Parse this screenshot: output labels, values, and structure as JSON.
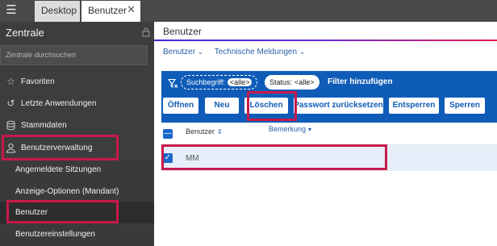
{
  "topbar": {
    "menu_icon": "hamburger-menu-icon",
    "tabs": [
      {
        "label": "Desktop"
      },
      {
        "label": "Benutzer",
        "close_icon": "close-icon"
      }
    ]
  },
  "sidebar": {
    "title": "Zentrale",
    "search_placeholder": "Zentrale durchsuchen",
    "items": [
      {
        "label": "Favoriten",
        "icon": "star-icon"
      },
      {
        "label": "Letzte Anwendungen",
        "icon": "history-icon"
      },
      {
        "label": "Stammdaten",
        "icon": "database-icon"
      },
      {
        "label": "Benutzerverwaltung",
        "icon": "user-icon"
      }
    ],
    "sub_items": [
      {
        "label": "Angemeldete Sitzungen"
      },
      {
        "label": "Anzeige-Optionen (Mandant)"
      },
      {
        "label": "Benutzer"
      },
      {
        "label": "Benutzereinstellungen"
      }
    ]
  },
  "main": {
    "title": "Benutzer",
    "breadcrumb": [
      {
        "label": "Benutzer"
      },
      {
        "label": "Technische Meldungen"
      }
    ],
    "filter": {
      "search_label": "Suchbegriff:",
      "search_value": "<alle>",
      "status_label": "Status:",
      "status_value": "<alle>",
      "add_filter": "Filter hinzufügen"
    },
    "buttons": [
      {
        "label": "Öffnen"
      },
      {
        "label": "Neu"
      },
      {
        "label": "Löschen"
      },
      {
        "label": "Passwort zurücksetzen"
      },
      {
        "label": "Entsperren"
      },
      {
        "label": "Sperren"
      }
    ],
    "table": {
      "columns": [
        {
          "label": "Benutzer",
          "sort": "neutral"
        },
        {
          "label": "Bemerkung",
          "sort": "descending"
        }
      ],
      "rows": [
        {
          "benutzer": "MM",
          "bemerkung": "",
          "selected": true
        }
      ]
    }
  },
  "colors": {
    "sidebar_bg": "#3d3d3d",
    "toolbar_bg": "#0f5cb8",
    "highlight": "#c8194a",
    "selected_row": "#e6eff9"
  }
}
